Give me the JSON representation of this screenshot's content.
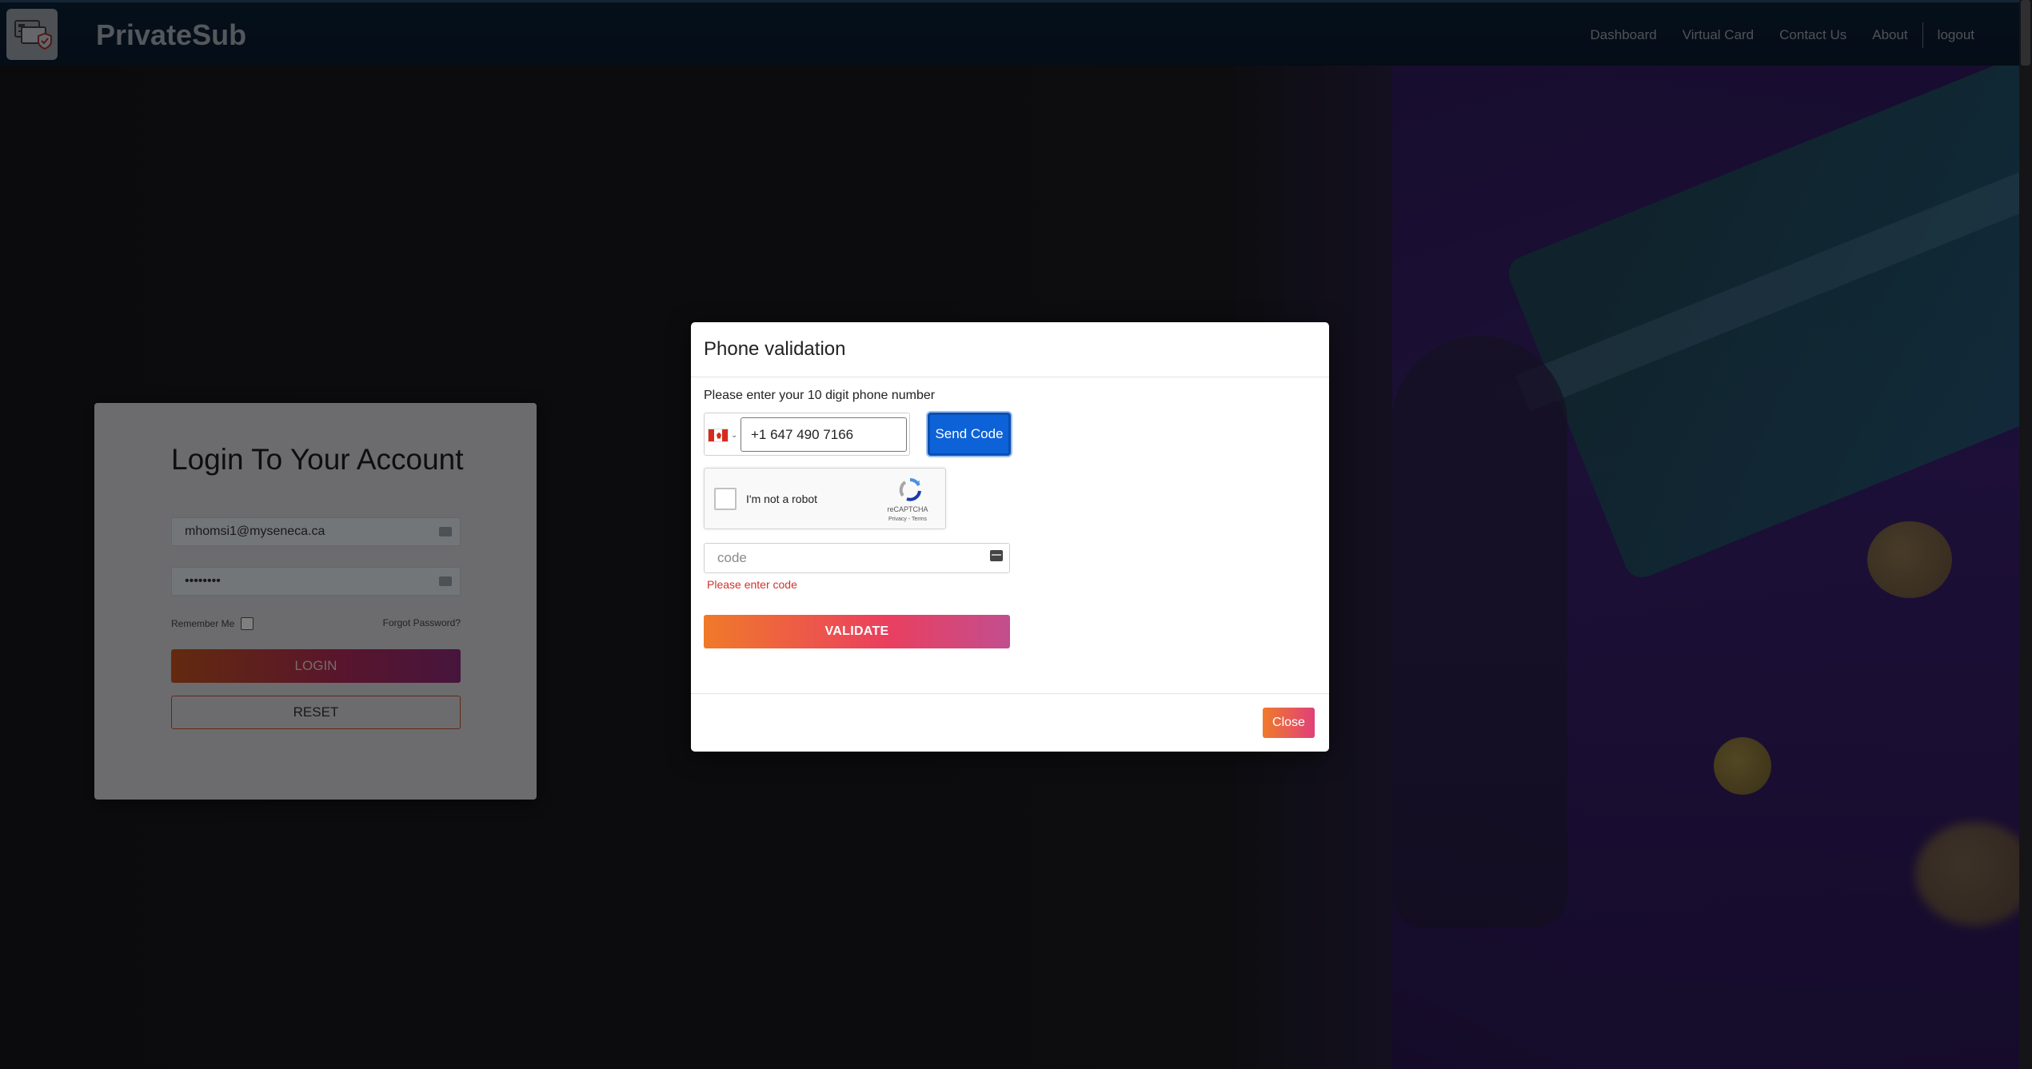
{
  "navbar": {
    "brand": "PrivateSub",
    "links": [
      "Dashboard",
      "Virtual Card",
      "Contact Us",
      "About",
      "logout"
    ]
  },
  "login": {
    "title": "Login To Your Account",
    "email_value": "mhomsi1@myseneca.ca",
    "password_value": "••••••••",
    "remember_label": "Remember Me",
    "forgot_label": "Forgot Password?",
    "login_button": "LOGIN",
    "reset_button": "RESET"
  },
  "modal": {
    "title": "Phone validation",
    "phone_label": "Please enter your 10 digit phone number",
    "country_flag": "canada-flag-icon",
    "phone_value": "+1 647 490 7166",
    "send_button": "Send Code",
    "recaptcha": {
      "label": "I'm not a robot",
      "brand": "reCAPTCHA",
      "links": "Privacy - Terms"
    },
    "code_placeholder": "code",
    "code_error": "Please enter code",
    "validate_button": "VALIDATE",
    "close_button": "Close"
  },
  "colors": {
    "send_button": "#0d62d8",
    "error_text": "#d0342c",
    "navbar_bg": "#0b2036"
  }
}
